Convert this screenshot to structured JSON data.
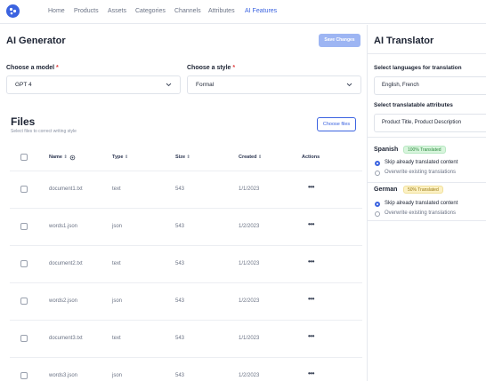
{
  "nav": {
    "items": [
      {
        "label": "Home",
        "active": false
      },
      {
        "label": "Products",
        "active": false
      },
      {
        "label": "Assets",
        "active": false
      },
      {
        "label": "Categories",
        "active": false
      },
      {
        "label": "Channels",
        "active": false
      },
      {
        "label": "Attributes",
        "active": false
      },
      {
        "label": "AI Features",
        "active": true
      }
    ]
  },
  "generator": {
    "title": "AI Generator",
    "save_label": "Save Changes",
    "model_label": "Choose a model",
    "model_value": "GPT 4",
    "style_label": "Choose a style",
    "style_value": "Formal",
    "required_mark": "*"
  },
  "files": {
    "title": "Files",
    "subtitle": "Select files to correct writing style",
    "choose_label": "Choose files",
    "columns": {
      "name": "Name",
      "type": "Type",
      "size": "Size",
      "created": "Created",
      "actions": "Actions"
    },
    "rows": [
      {
        "name": "document1.txt",
        "type": "text",
        "size": "543",
        "created": "1/1/2023"
      },
      {
        "name": "words1.json",
        "type": "json",
        "size": "543",
        "created": "1/2/2023"
      },
      {
        "name": "document2.txt",
        "type": "text",
        "size": "543",
        "created": "1/1/2023"
      },
      {
        "name": "words2.json",
        "type": "json",
        "size": "543",
        "created": "1/2/2023"
      },
      {
        "name": "document3.txt",
        "type": "text",
        "size": "543",
        "created": "1/1/2023"
      },
      {
        "name": "words3.json",
        "type": "json",
        "size": "543",
        "created": "1/2/2023"
      }
    ],
    "actions_glyph": "•••"
  },
  "translator": {
    "title": "AI Translator",
    "languages_label": "Select languages for translation",
    "languages_value": "English, French",
    "attributes_label": "Select translatable attributes",
    "attributes_value": "Product Title, Product Description",
    "languages": [
      {
        "name": "Spanish",
        "badge": "100% Translated",
        "badge_color": "green",
        "options": [
          {
            "label": "Skip already translated content",
            "selected": true
          },
          {
            "label": "Overwrite existing translations",
            "selected": false
          }
        ]
      },
      {
        "name": "German",
        "badge": "50% Translated",
        "badge_color": "yellow",
        "options": [
          {
            "label": "Skip already translated content",
            "selected": true
          },
          {
            "label": "Overwrite existing translations",
            "selected": false
          }
        ]
      }
    ]
  },
  "colors": {
    "accent": "#3b63e0",
    "save_disabled": "#9db5f3"
  }
}
